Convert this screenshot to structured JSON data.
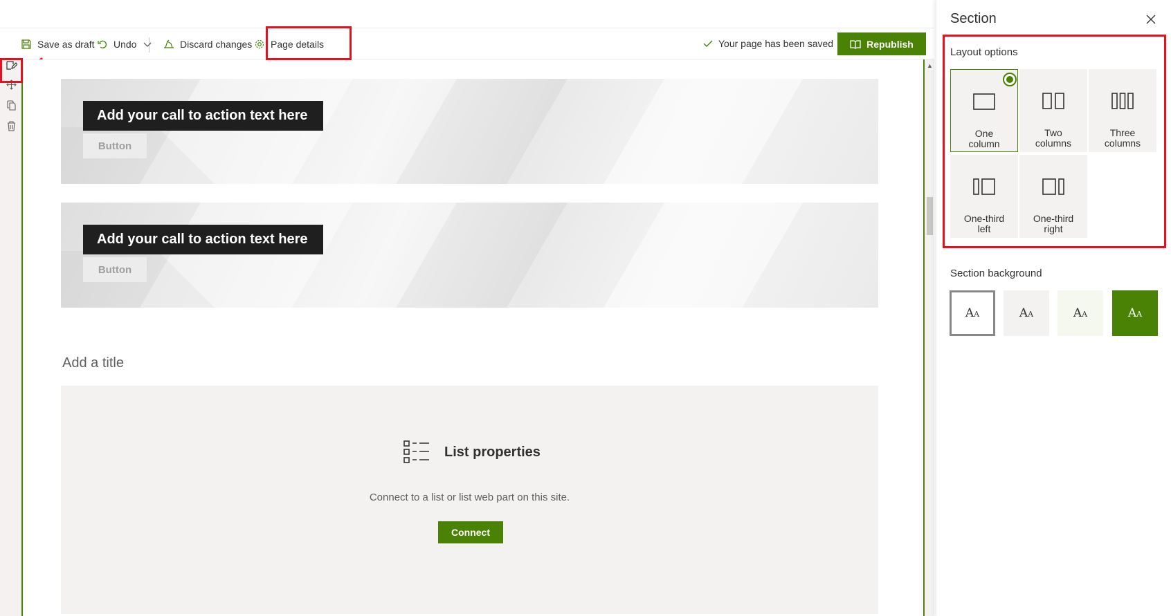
{
  "commandbar": {
    "save_draft": "Save as draft",
    "undo": "Undo",
    "discard": "Discard changes",
    "page_details": "Page details",
    "saved_status": "Your page has been saved",
    "republish": "Republish"
  },
  "toolbox": {
    "tools": [
      "edit-section-icon",
      "move-icon",
      "duplicate-icon",
      "delete-icon"
    ]
  },
  "canvas": {
    "banners": [
      {
        "cta_text": "Add your call to action text here",
        "button_label": "Button"
      },
      {
        "cta_text": "Add your call to action text here",
        "button_label": "Button"
      }
    ],
    "title_placeholder": "Add a title",
    "list_properties": {
      "title": "List properties",
      "description": "Connect to a list or list web part on this site.",
      "connect_label": "Connect"
    }
  },
  "panel": {
    "title": "Section",
    "layout_label": "Layout options",
    "layouts": [
      {
        "label": "One\ncolumn",
        "selected": true
      },
      {
        "label": "Two\ncolumns",
        "selected": false
      },
      {
        "label": "Three\ncolumns",
        "selected": false
      },
      {
        "label": "One-third\nleft",
        "selected": false
      },
      {
        "label": "One-third\nright",
        "selected": false
      }
    ],
    "background_label": "Section background",
    "backgrounds": [
      {
        "glyph": "AA",
        "color": "#ffffff",
        "selected": true
      },
      {
        "glyph": "AA",
        "color": "#f3f2f1",
        "selected": false
      },
      {
        "glyph": "AA",
        "color": "#f4f8ef",
        "selected": false
      },
      {
        "glyph": "AA",
        "color": "#498205",
        "selected": false
      }
    ]
  },
  "colors": {
    "accent": "#498205",
    "highlight": "#e3121e"
  }
}
